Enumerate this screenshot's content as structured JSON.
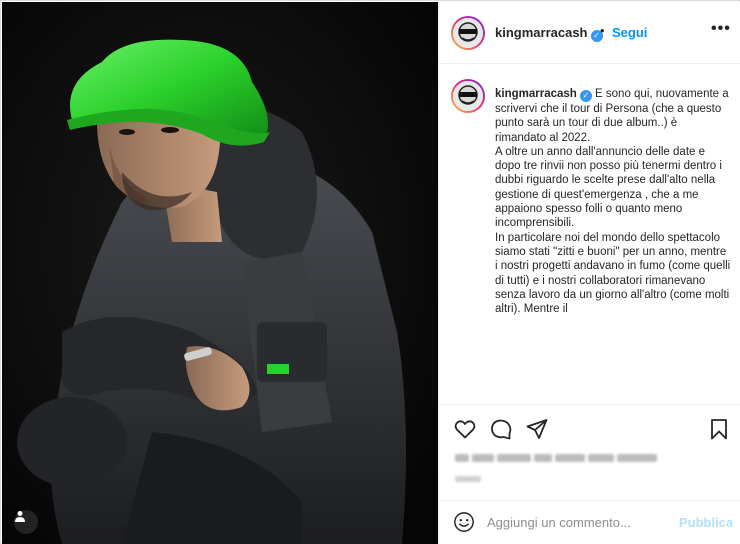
{
  "post": {
    "username": "kingmarracash",
    "verified_symbol": "✓",
    "dot": "•",
    "follow_label": "Segui",
    "more_label": "•••",
    "caption_username": "kingmarracash",
    "caption_text": "E sono qui, nuovamente a scrivervi che il tour di Persona (che a questo punto sarà un tour di due album..) è rimandato al 2022.\nA oltre un anno dall'annuncio delle date e dopo tre rinvii non posso più tenermi dentro i dubbi riguardo le scelte prese dall'alto nella gestione di quest'emergenza , che a me appaiono spesso folli o quanto meno incomprensibili.\nIn particolare noi del mondo dello spettacolo siamo stati \"zitti e buoni\" per un anno, mentre i nostri progetti andavano in fumo (come quelli di tutti) e i nostri collaboratori rimanevano senza lavoro da un giorno all'altro (come molti altri). Mentre il"
  },
  "actions": {
    "like_icon": "heart-icon",
    "comment_icon": "comment-icon",
    "share_icon": "share-icon",
    "save_icon": "bookmark-icon"
  },
  "comment": {
    "placeholder": "Aggiungi un commento...",
    "publish_label": "Pubblica",
    "emoji_icon": "emoji-icon"
  },
  "colors": {
    "accent": "#0095f6",
    "publish_disabled": "#b2dffc",
    "hat_green": "#2bd12b",
    "verified": "#3897f0"
  }
}
